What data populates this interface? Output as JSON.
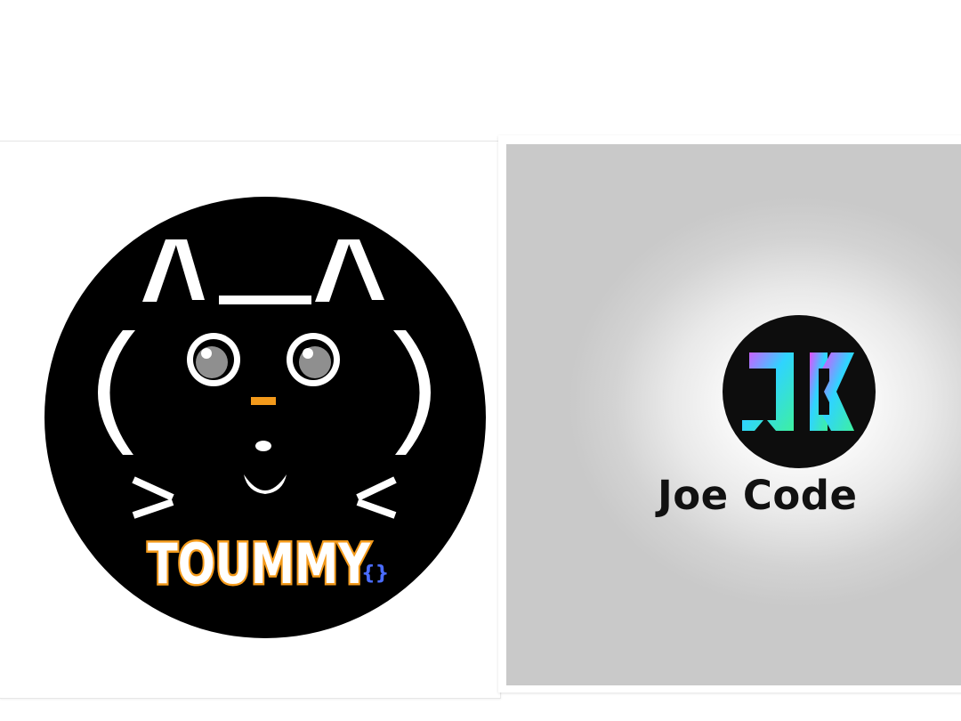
{
  "left_logo": {
    "wordmark": "TOUMMY",
    "brace_text": "{}",
    "colors": {
      "circle": "#000000",
      "lines": "#ffffff",
      "accent": "#f39a1b",
      "eye_gray": "#8f8f8f"
    }
  },
  "right_logo": {
    "monogram": "JC",
    "caption": "Joe Code",
    "colors": {
      "circle": "#0d0d0d",
      "gradient_start": "#e44cff",
      "gradient_mid": "#2fd4ff",
      "gradient_end": "#3ef0a0",
      "text": "#111111"
    }
  }
}
